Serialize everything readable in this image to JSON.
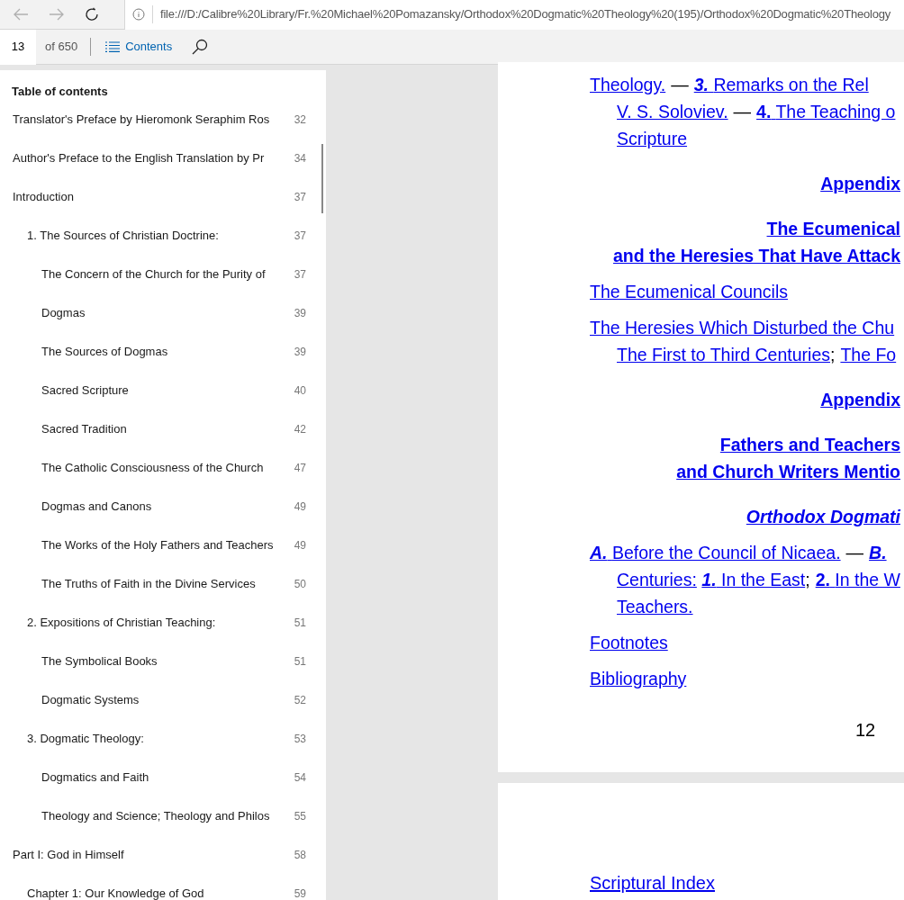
{
  "browser": {
    "address": "file:///D:/Calibre%20Library/Fr.%20Michael%20Pomazansky/Orthodox%20Dogmatic%20Theology%20(195)/Orthodox%20Dogmatic%20Theology"
  },
  "toolbar": {
    "page": "13",
    "page_count": "of 650",
    "contents_button": "Contents"
  },
  "toc": {
    "title": "Table of contents",
    "items": [
      {
        "title": "Translator's Preface by Hieromonk Seraphim Ros",
        "page": "32"
      },
      {
        "title": "Author's Preface to the English Translation by Pr",
        "page": "34"
      },
      {
        "title": "Introduction",
        "page": "37",
        "children": [
          {
            "title": "1. The Sources of Christian Doctrine:",
            "page": "37",
            "children": [
              {
                "title": "The Concern of the Church for the Purity of",
                "page": "37"
              },
              {
                "title": "Dogmas",
                "page": "39"
              },
              {
                "title": "The Sources of Dogmas",
                "page": "39"
              },
              {
                "title": "Sacred Scripture",
                "page": "40"
              },
              {
                "title": "Sacred Tradition",
                "page": "42"
              },
              {
                "title": "The Catholic Consciousness of the Church",
                "page": "47"
              },
              {
                "title": "Dogmas and Canons",
                "page": "49"
              },
              {
                "title": "The Works of the Holy Fathers and Teachers",
                "page": "49"
              },
              {
                "title": "The Truths of Faith in the Divine Services",
                "page": "50"
              }
            ]
          },
          {
            "title": "2. Expositions of Christian Teaching:",
            "page": "51",
            "children": [
              {
                "title": "The Symbolical Books",
                "page": "51"
              },
              {
                "title": "Dogmatic Systems",
                "page": "52"
              }
            ]
          },
          {
            "title": "3. Dogmatic Theology:",
            "page": "53",
            "children": [
              {
                "title": "Dogmatics and Faith",
                "page": "54"
              },
              {
                "title": "Theology and Science; Theology and Philos",
                "page": "55"
              }
            ]
          }
        ]
      },
      {
        "title": "Part I: God in Himself",
        "page": "58",
        "children": [
          {
            "title": "Chapter 1: Our Knowledge of God",
            "page": "59"
          }
        ]
      }
    ]
  },
  "page": {
    "blocks": [
      {
        "kind": "entry",
        "lines": [
          [
            {
              "kind": "link",
              "text": "Theology."
            },
            {
              "kind": "sep",
              "text": "—"
            },
            {
              "kind": "link",
              "label": "3.",
              "label_italic": true,
              "text": "Remarks on the Rel"
            }
          ],
          [
            {
              "kind": "link",
              "text": "V. S. Soloviev."
            },
            {
              "kind": "sep",
              "text": "—"
            },
            {
              "kind": "link",
              "label": "4.",
              "label_italic": false,
              "text": "The Teaching o"
            }
          ],
          [
            {
              "kind": "link",
              "text": "Scripture"
            }
          ]
        ]
      },
      {
        "kind": "heading",
        "italic": false,
        "lines": [
          "Appendix"
        ]
      },
      {
        "kind": "heading",
        "italic": false,
        "lines": [
          "The Ecumenical",
          "and the Heresies That Have Attack"
        ]
      },
      {
        "kind": "entry",
        "lines": [
          [
            {
              "kind": "link",
              "text": "The Ecumenical Councils"
            }
          ]
        ]
      },
      {
        "kind": "entry",
        "lines": [
          [
            {
              "kind": "link",
              "text": "The Heresies Which Disturbed the Chu"
            }
          ],
          [
            {
              "kind": "link",
              "text": "The First to Third Centuries"
            },
            {
              "kind": "punct",
              "text": ";"
            },
            {
              "kind": "link",
              "text": "The Fo"
            }
          ]
        ]
      },
      {
        "kind": "heading",
        "italic": false,
        "lines": [
          "Appendix"
        ]
      },
      {
        "kind": "heading",
        "italic": false,
        "lines": [
          "Fathers and Teachers",
          "and Church Writers Mentio"
        ]
      },
      {
        "kind": "heading",
        "italic": true,
        "lines": [
          "Orthodox Dogmati"
        ]
      },
      {
        "kind": "entry",
        "lines": [
          [
            {
              "kind": "link",
              "label": "A.",
              "label_italic": true,
              "text": "Before the Council of Nicaea."
            },
            {
              "kind": "sep",
              "text": "—"
            },
            {
              "kind": "link",
              "label": "B.",
              "label_italic": true
            }
          ],
          [
            {
              "kind": "link",
              "text": "Centuries:"
            },
            {
              "kind": "link",
              "label": "1.",
              "label_italic": true,
              "text": "In the East"
            },
            {
              "kind": "punct",
              "text": ";"
            },
            {
              "kind": "link",
              "label": "2.",
              "label_italic": false,
              "text": "In the W"
            }
          ],
          [
            {
              "kind": "link",
              "text": "Teachers."
            }
          ]
        ]
      },
      {
        "kind": "entry",
        "lines": [
          [
            {
              "kind": "link",
              "text": "Footnotes"
            }
          ]
        ]
      },
      {
        "kind": "entry",
        "lines": [
          [
            {
              "kind": "link",
              "text": "Bibliography"
            }
          ]
        ]
      }
    ],
    "page_number": "12"
  },
  "next_page": {
    "blocks": [
      {
        "kind": "entry",
        "lines": [
          [
            {
              "kind": "link",
              "text": "Scriptural Index"
            }
          ]
        ]
      }
    ]
  }
}
